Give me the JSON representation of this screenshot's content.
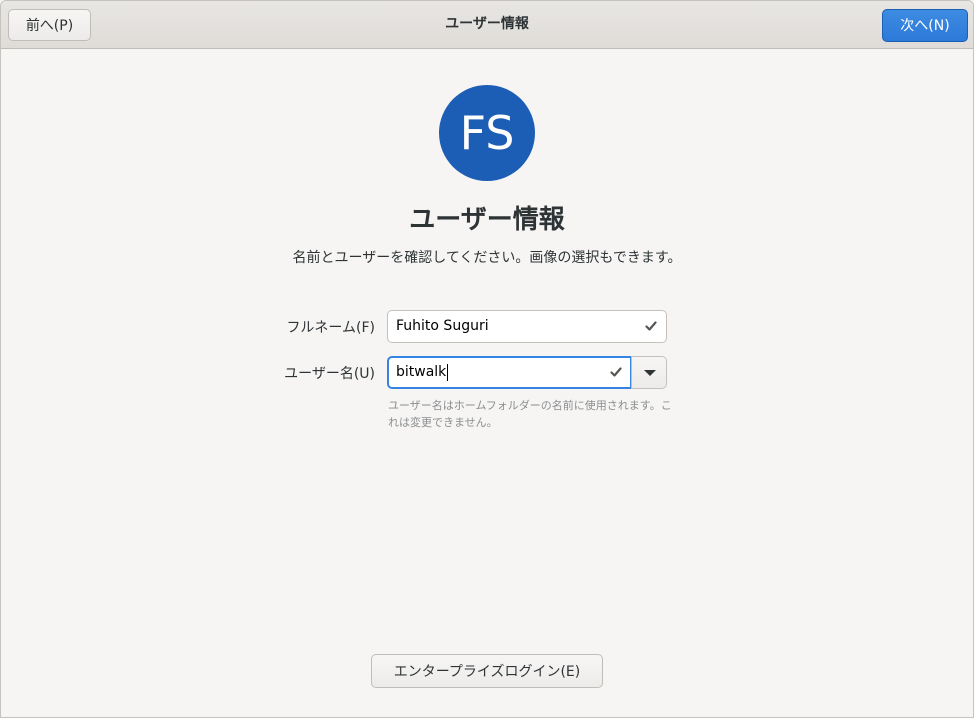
{
  "header": {
    "title": "ユーザー情報",
    "prev_label": "前へ(P)",
    "next_label": "次へ(N)"
  },
  "avatar": {
    "initials": "FS",
    "color": "#1c5eb5"
  },
  "main": {
    "title": "ユーザー情報",
    "subtitle": "名前とユーザーを確認してください。画像の選択もできます。"
  },
  "form": {
    "fullname": {
      "label": "フルネーム(F)",
      "value": "Fuhito Suguri"
    },
    "username": {
      "label": "ユーザー名(U)",
      "value": "bitwalk",
      "hint": "ユーザー名はホームフォルダーの名前に使用されます。これは変更できません。"
    }
  },
  "footer": {
    "enterprise_login_label": "エンタープライズログイン(E)"
  },
  "colors": {
    "accent": "#3584e4",
    "next_button": "#3584e4"
  },
  "icons": {
    "valid": "check-icon",
    "dropdown": "caret-down-icon"
  }
}
